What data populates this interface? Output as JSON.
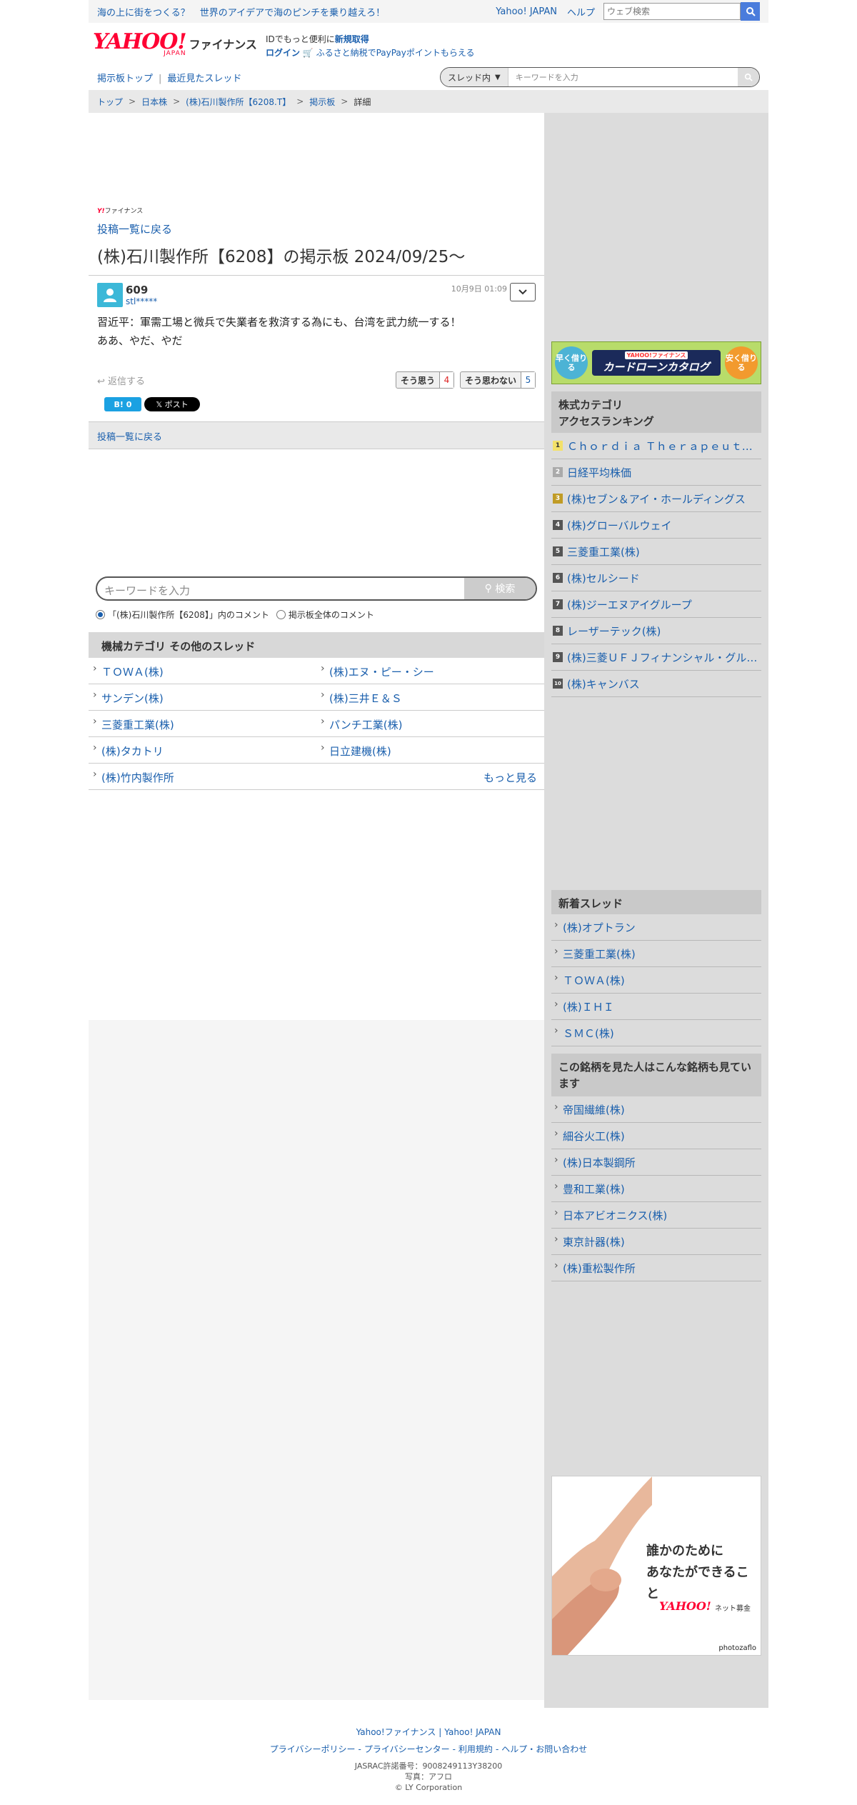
{
  "topbar": {
    "promo1": "海の上に街をつくる？",
    "promo2": "世界のアイデアで海のピンチを乗り越えろ！",
    "yahoo_japan": "Yahoo! JAPAN",
    "help": "ヘルプ",
    "web_search_placeholder": "ウェブ検索"
  },
  "header": {
    "logo_text": "YAHOO!",
    "logo_sub": "JAPAN",
    "section": "ファイナンス",
    "id_line_prefix": "IDでもっと便利に",
    "signup": "新規取得",
    "login": "ログイン",
    "furusato": "ふるさと納税でPayPayポイントもらえる"
  },
  "subnav": {
    "bbs_top": "掲示板トップ",
    "recent": "最近見たスレッド",
    "scope": "スレッド内",
    "keyword_placeholder": "キーワードを入力"
  },
  "breadcrumb": [
    "トップ",
    "日本株",
    "(株)石川製作所【6208.T】",
    "掲示板",
    "詳細"
  ],
  "main": {
    "mini_logo_y": "Y!",
    "mini_logo_text": "ファイナンス",
    "back_to_list": "投稿一覧に戻る",
    "title": "(株)石川製作所【6208】の掲示板 2024/09/25〜",
    "post": {
      "number": "609",
      "user_id": "stl*****",
      "date": "10月9日 01:09",
      "line1": "習近平：軍需工場と微兵で失業者を救済する為にも、台湾を武力統一する！",
      "line2": "ああ、やだ、やだ",
      "reply": "返信する",
      "agree_label": "そう思う",
      "agree_count": "4",
      "disagree_label": "そう思わない",
      "disagree_count": "5",
      "hatena": "B! 0",
      "x_post": "𝕏 ポスト"
    },
    "back_to_list2": "投稿一覧に戻る",
    "search": {
      "placeholder": "キーワードを入力",
      "button": "検索",
      "radio1": "「(株)石川製作所【6208】」内のコメント",
      "radio2": "掲示板全体のコメント"
    },
    "category": {
      "heading": "機械カテゴリ その他のスレッド",
      "items": [
        "ＴＯＷＡ(株)",
        "(株)エヌ・ピー・シー",
        "サンデン(株)",
        "(株)三井Ｅ＆Ｓ",
        "三菱重工業(株)",
        "パンチ工業(株)",
        "(株)タカトリ",
        "日立建機(株)",
        "(株)竹内製作所"
      ],
      "more": "もっと見る"
    }
  },
  "side": {
    "card_ad": {
      "left": "早く借りる",
      "small": "YAHOO!ファイナンス",
      "big": "カードローンカタログ",
      "right": "安く借りる"
    },
    "ranking": {
      "heading1": "株式カテゴリ",
      "heading2": "アクセスランキング",
      "items": [
        "Ｃｈｏｒｄｉａ Ｔｈｅｒａｐｅｕｔｉｃｓ(株)",
        "日経平均株価",
        "(株)セブン＆アイ・ホールディングス",
        "(株)グローバルウェイ",
        "三菱重工業(株)",
        "(株)セルシード",
        "(株)ジーエヌアイグループ",
        "レーザーテック(株)",
        "(株)三菱ＵＦＪフィナンシャル・グループ",
        "(株)キャンバス"
      ],
      "numbers": [
        "1",
        "2",
        "3",
        "4",
        "5",
        "6",
        "7",
        "8",
        "9",
        "10"
      ]
    },
    "new_threads": {
      "heading": "新着スレッド",
      "items": [
        "(株)オプトラン",
        "三菱重工業(株)",
        "ＴＯＷＡ(株)",
        "(株)ＩＨＩ",
        "ＳＭＣ(株)"
      ]
    },
    "also_viewed": {
      "heading": "この銘柄を見た人はこんな銘柄も見ています",
      "items": [
        "帝国繊維(株)",
        "細谷火工(株)",
        "(株)日本製鋼所",
        "豊和工業(株)",
        "日本アビオニクス(株)",
        "東京計器(株)",
        "(株)重松製作所"
      ]
    },
    "donate_ad": {
      "line1": "誰かのために",
      "line2": "あなたができること",
      "logo": "YAHOO!",
      "sub": "ネット募金",
      "photo": "photozaflo"
    }
  },
  "footer": {
    "link1": "Yahoo!ファイナンス",
    "link2": "Yahoo! JAPAN",
    "privacy": "プライバシーポリシー",
    "privacy_center": "プライバシーセンター",
    "terms": "利用規約",
    "help": "ヘルプ・お問い合わせ",
    "jasrac": "JASRAC許諾番号：9008249113Y38200",
    "photo": "写真：アフロ",
    "copyright": "© LY Corporation"
  },
  "colors": {
    "link": "#1a5fad",
    "brand_red": "#ff0033",
    "sidebar_bg": "#dcdcdc"
  }
}
